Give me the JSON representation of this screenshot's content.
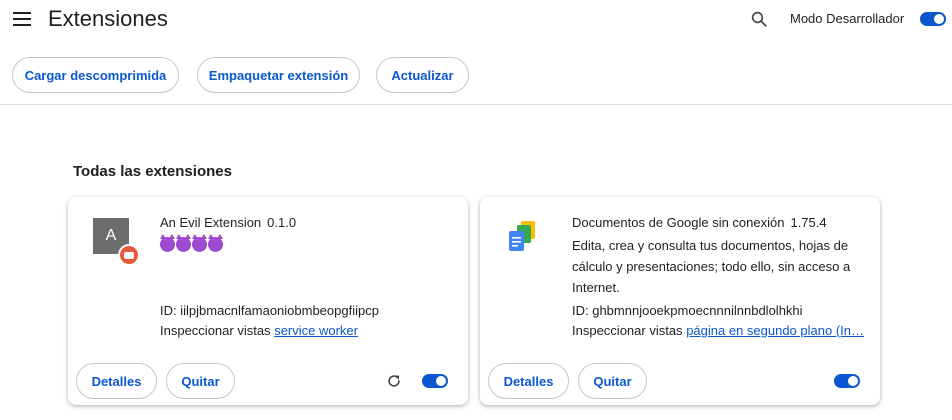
{
  "header": {
    "title": "Extensiones",
    "dev_mode_label": "Modo Desarrollador",
    "dev_mode_enabled": true
  },
  "toolbar": {
    "load_unpacked": "Cargar descomprimida",
    "pack_extension": "Empaquetar extensión",
    "update": "Actualizar"
  },
  "section": {
    "title": "Todas las extensiones"
  },
  "extensions": [
    {
      "name": "An Evil Extension",
      "version": "0.1.0",
      "description_icons": [
        "devil-emoji",
        "devil-emoji",
        "devil-emoji",
        "devil-emoji"
      ],
      "icon_letter": "A",
      "id_text": "ID: iilpjbmacnlfamaoniobmbeopgfiipcp",
      "inspect_label": "Inspeccionar vistas",
      "inspect_link": "service worker",
      "details_label": "Detalles",
      "remove_label": "Quitar",
      "enabled": true
    },
    {
      "name": "Documentos de Google sin conexión",
      "version": "1.75.4",
      "description_lines": [
        "Edita, crea y consulta tus documentos, hojas de",
        "cálculo y presentaciones; todo ello, sin acceso a",
        "Internet."
      ],
      "id_text": "ID: ghbmnnjooekpmoecnnnilnnbdlolhkhi",
      "inspect_label": "Inspeccionar vistas",
      "inspect_link": "página en segundo plano (In…",
      "details_label": "Detalles",
      "remove_label": "Quitar",
      "enabled": true
    }
  ],
  "colors": {
    "accent": "#0b57d0",
    "text": "#1f1f1f",
    "border": "#c7c7c7",
    "divider": "#dadce0"
  }
}
